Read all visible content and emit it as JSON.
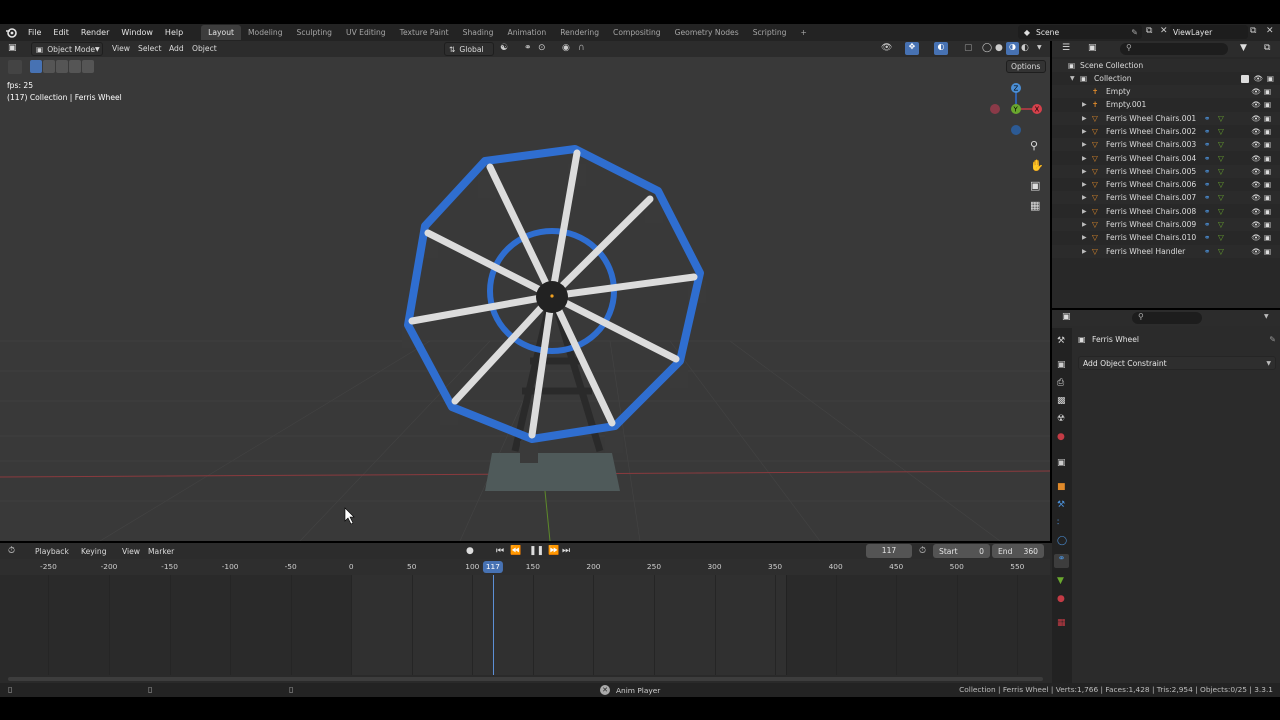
{
  "topbar": {
    "menus": [
      "File",
      "Edit",
      "Render",
      "Window",
      "Help"
    ],
    "workspaces": [
      "Layout",
      "Modeling",
      "Sculpting",
      "UV Editing",
      "Texture Paint",
      "Shading",
      "Animation",
      "Rendering",
      "Compositing",
      "Geometry Nodes",
      "Scripting"
    ],
    "active_workspace": "Layout",
    "add_tab_symbol": "+",
    "scene_name": "Scene",
    "view_layer_name": "ViewLayer"
  },
  "viewport": {
    "mode_label": "Object Mode",
    "menus": [
      "View",
      "Select",
      "Add",
      "Object"
    ],
    "transform_orientation": "Global",
    "options_label": "Options",
    "fps_text": "fps: 25",
    "info_text": "(117) Collection | Ferris Wheel",
    "gizmo_axis": {
      "x": "X",
      "y": "Y",
      "z": "Z"
    }
  },
  "timeline": {
    "menus": [
      "Playback",
      "Keying",
      "View",
      "Marker"
    ],
    "current_frame": "117",
    "start_label": "Start",
    "start_value": "0",
    "end_label": "End",
    "end_value": "360",
    "ruler_ticks": [
      "-250",
      "-200",
      "-150",
      "-100",
      "-50",
      "0",
      "50",
      "100",
      "150",
      "200",
      "250",
      "300",
      "350",
      "400",
      "450",
      "500",
      "550"
    ],
    "scene_start": 0,
    "scene_end": 360,
    "view_min": -290,
    "view_max": 577
  },
  "outliner": {
    "scene_collection": "Scene Collection",
    "collection": "Collection",
    "items": [
      "Empty",
      "Empty.001",
      "Ferris Wheel Chairs.001",
      "Ferris Wheel Chairs.002",
      "Ferris Wheel Chairs.003",
      "Ferris Wheel Chairs.004",
      "Ferris Wheel Chairs.005",
      "Ferris Wheel Chairs.006",
      "Ferris Wheel Chairs.007",
      "Ferris Wheel Chairs.008",
      "Ferris Wheel Chairs.009",
      "Ferris Wheel Chairs.010",
      "Ferris Wheel Handler"
    ]
  },
  "properties": {
    "object_name": "Ferris Wheel",
    "add_constraint_label": "Add Object Constraint"
  },
  "statusbar": {
    "center_label": "Anim Player",
    "stats": "Collection | Ferris Wheel | Verts:1,766 | Faces:1,428 | Tris:2,954 | Objects:0/25 | 3.3.1"
  },
  "colors": {
    "accent_blue": "#4772b3",
    "wheel_blue": "#2f6ed0",
    "timeline_cursor": "#5c8fd6",
    "axis_red": "#c33b45",
    "axis_green": "#6aa82e"
  }
}
